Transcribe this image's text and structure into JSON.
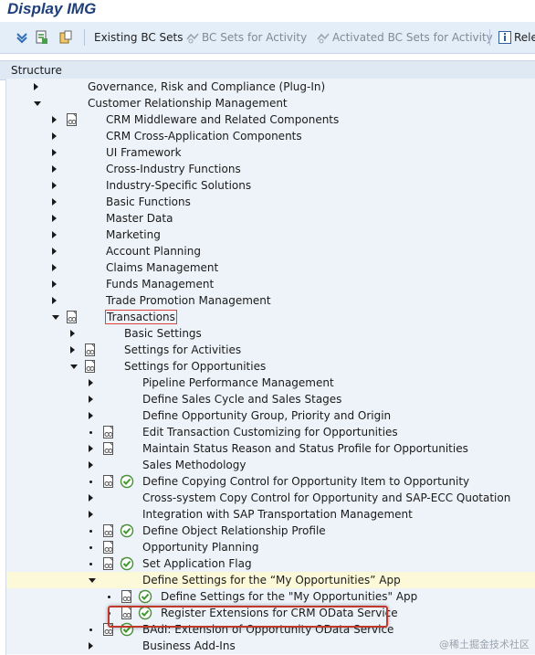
{
  "window": {
    "title": "Display IMG"
  },
  "toolbar": {
    "existing_bc_sets": "Existing BC Sets",
    "bc_sets_activity": "BC Sets for Activity",
    "activated_bc_sets": "Activated BC Sets for Activity",
    "release_notes": "Rele"
  },
  "structure": {
    "header": "Structure"
  },
  "tree": [
    {
      "label": "Governance, Risk and Compliance (Plug-In)"
    },
    {
      "label": "Customer Relationship Management"
    },
    {
      "label": "CRM Middleware and Related Components"
    },
    {
      "label": "CRM Cross-Application Components"
    },
    {
      "label": "UI Framework"
    },
    {
      "label": "Cross-Industry Functions"
    },
    {
      "label": "Industry-Specific Solutions"
    },
    {
      "label": "Basic Functions"
    },
    {
      "label": "Master Data"
    },
    {
      "label": "Marketing"
    },
    {
      "label": "Account Planning"
    },
    {
      "label": "Claims Management"
    },
    {
      "label": "Funds Management"
    },
    {
      "label": "Trade Promotion Management"
    },
    {
      "label": "Transactions"
    },
    {
      "label": "Basic Settings"
    },
    {
      "label": "Settings for Activities"
    },
    {
      "label": "Settings for Opportunities"
    },
    {
      "label": "Pipeline Performance Management"
    },
    {
      "label": "Define Sales Cycle and Sales Stages"
    },
    {
      "label": "Define Opportunity Group, Priority and Origin"
    },
    {
      "label": "Edit Transaction Customizing for Opportunities"
    },
    {
      "label": "Maintain Status Reason and Status Profile for Opportunities"
    },
    {
      "label": "Sales Methodology"
    },
    {
      "label": "Define Copying Control for Opportunity Item to Opportunity"
    },
    {
      "label": "Cross-system Copy Control for Opportunity and SAP-ECC Quotation"
    },
    {
      "label": "Integration with SAP Transportation Management"
    },
    {
      "label": "Define Object Relationship Profile"
    },
    {
      "label": "Opportunity Planning"
    },
    {
      "label": "Set Application Flag"
    },
    {
      "label": "Define Settings for the “My Opportunities” App"
    },
    {
      "label": "Define Settings for the \"My Opportunities\" App"
    },
    {
      "label": "Register Extensions for CRM OData Service"
    },
    {
      "label": "BAdI: Extension of Opportunity OData Service"
    },
    {
      "label": "Business Add-Ins"
    }
  ],
  "watermark": "@稀土掘金技术社区",
  "colors": {
    "title": "#1e3f7a",
    "toolbar_bg": "#e4eef8",
    "highlight_row": "#fbf9d7",
    "callout": "#c0392b"
  }
}
